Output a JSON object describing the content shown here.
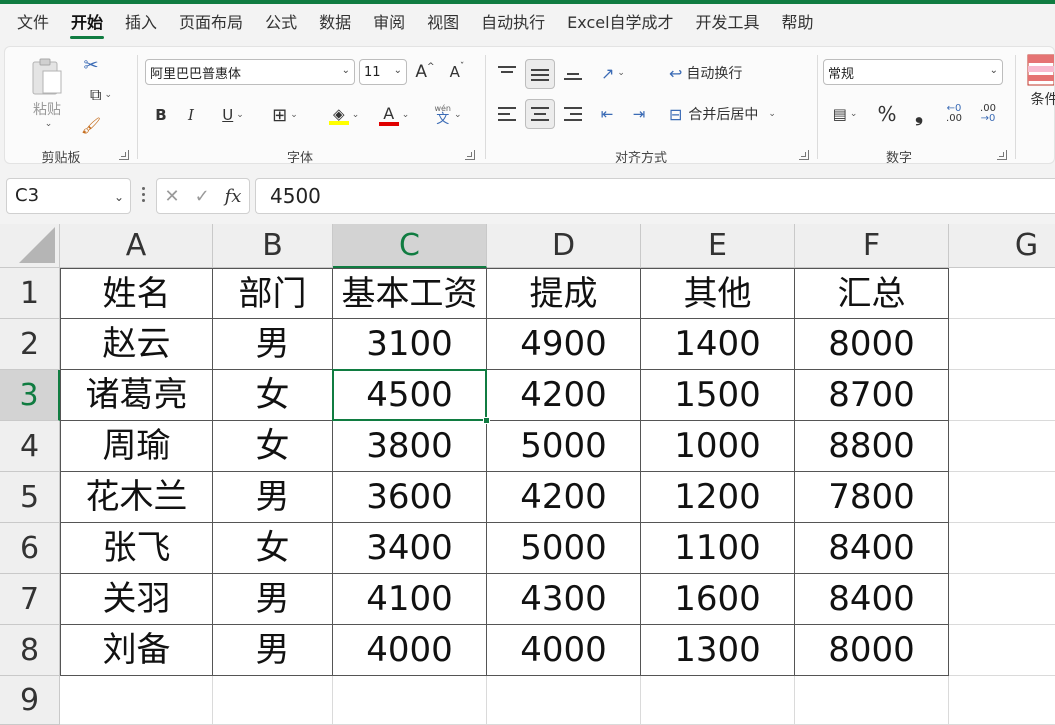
{
  "menu": {
    "tabs": [
      {
        "label": "文件"
      },
      {
        "label": "开始",
        "active": true
      },
      {
        "label": "插入"
      },
      {
        "label": "页面布局"
      },
      {
        "label": "公式"
      },
      {
        "label": "数据"
      },
      {
        "label": "审阅"
      },
      {
        "label": "视图"
      },
      {
        "label": "自动执行"
      },
      {
        "label": "Excel自学成才"
      },
      {
        "label": "开发工具"
      },
      {
        "label": "帮助"
      }
    ]
  },
  "ribbon": {
    "clipboard": {
      "paste_label": "粘贴",
      "group_label": "剪贴板"
    },
    "font": {
      "font_name": "阿里巴巴普惠体",
      "font_size": "11",
      "grow": "A",
      "shrink": "A",
      "bold": "B",
      "italic": "I",
      "underline": "U",
      "font_color_letter": "A",
      "phonetic_top": "wén",
      "phonetic_bottom": "文",
      "group_label": "字体",
      "fill_color": "#ffff00",
      "font_color": "#e00000"
    },
    "alignment": {
      "wrap_text": "自动换行",
      "merge_center": "合并后居中",
      "group_label": "对齐方式"
    },
    "number": {
      "format": "常规",
      "percent": "%",
      "comma": "❟",
      "inc_decimal_top": "←0",
      "inc_decimal_bottom": ".00",
      "dec_decimal_top": ".00",
      "dec_decimal_bottom": "→0",
      "group_label": "数字"
    },
    "styles": {
      "conditional_label": "条件"
    }
  },
  "formula_bar": {
    "name_box": "C3",
    "cancel": "✕",
    "enter": "✓",
    "fx": "fx",
    "value": "4500"
  },
  "sheet": {
    "columns": [
      "A",
      "B",
      "C",
      "D",
      "E",
      "F",
      "G"
    ],
    "selected_column": "C",
    "selected_row": "3",
    "rows": [
      {
        "num": "1",
        "cells": [
          "姓名",
          "部门",
          "基本工资",
          "提成",
          "其他",
          "汇总"
        ]
      },
      {
        "num": "2",
        "cells": [
          "赵云",
          "男",
          "3100",
          "4900",
          "1400",
          "8000"
        ]
      },
      {
        "num": "3",
        "cells": [
          "诸葛亮",
          "女",
          "4500",
          "4200",
          "1500",
          "8700"
        ]
      },
      {
        "num": "4",
        "cells": [
          "周瑜",
          "女",
          "3800",
          "5000",
          "1000",
          "8800"
        ]
      },
      {
        "num": "5",
        "cells": [
          "花木兰",
          "男",
          "3600",
          "4200",
          "1200",
          "7800"
        ]
      },
      {
        "num": "6",
        "cells": [
          "张飞",
          "女",
          "3400",
          "5000",
          "1100",
          "8400"
        ]
      },
      {
        "num": "7",
        "cells": [
          "关羽",
          "男",
          "4100",
          "4300",
          "1600",
          "8400"
        ]
      },
      {
        "num": "8",
        "cells": [
          "刘备",
          "男",
          "4000",
          "4000",
          "1300",
          "8000"
        ]
      },
      {
        "num": "9",
        "cells": [
          "",
          "",
          "",
          "",
          "",
          ""
        ]
      }
    ],
    "accent_color": "#107c41"
  }
}
